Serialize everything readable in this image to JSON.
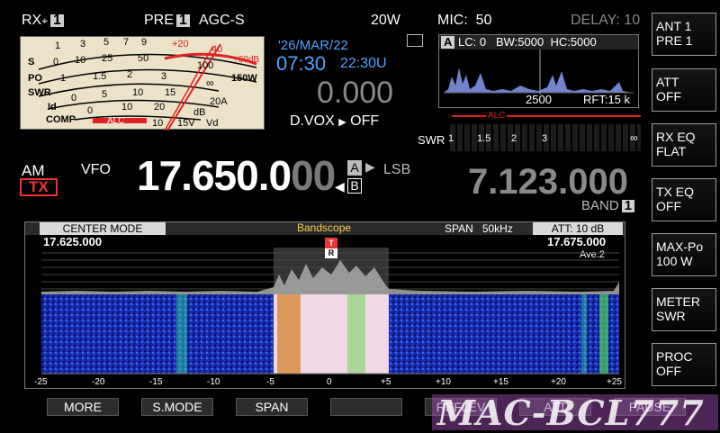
{
  "top": {
    "rx": "RX",
    "rx_badge": "1",
    "pre": "PRE",
    "pre_badge": "1",
    "agc": "AGC-S",
    "power": "20W",
    "mic_label": "MIC:",
    "mic_value": "50",
    "delay": "DELAY: 10"
  },
  "meter": {
    "s_scale_labels": [
      "1",
      "3",
      "5",
      "7",
      "9",
      "+20",
      "40",
      "+60dB"
    ],
    "po_scale_labels": [
      "0",
      "10",
      "25",
      "50",
      "100",
      "150W"
    ],
    "swr_scale_labels": [
      "1",
      "1.5",
      "2",
      "3",
      "∞"
    ],
    "id_scale_labels": [
      "0",
      "5",
      "10",
      "15",
      "20A"
    ],
    "comp_scale_labels": [
      "0",
      "10",
      "20",
      "dB"
    ],
    "vd_scale_labels": [
      "10",
      "15V",
      "Vd"
    ],
    "row_labels": [
      "S",
      "PO",
      "SWR",
      "Id",
      "COMP"
    ],
    "alc_label": "ALC"
  },
  "clock": {
    "date": "'26/MAR/22",
    "time_local": "07:30",
    "time_utc": "22:30U",
    "rit": "0.000",
    "dvox": "D.VOX",
    "dvox_state": "OFF"
  },
  "filter": {
    "badge": "A",
    "lc_label": "LC:",
    "lc_value": "0",
    "bw": "BW:5000",
    "hc": "HC:5000",
    "center_freq": "2500",
    "rft": "RFT:15 k"
  },
  "swr_meter": {
    "alc": "ALC",
    "label": "SWR",
    "ticks": [
      "1",
      "1.5",
      "2",
      "3",
      "∞"
    ]
  },
  "vfo_main": {
    "mode": "AM",
    "tx": "TX",
    "vfo": "VFO",
    "freq_bright": "17.650.0",
    "freq_dim": "00",
    "vfo_a": "A",
    "vfo_b": "B",
    "sideband": "LSB"
  },
  "vfo_sub": {
    "freq": "7.123.000",
    "band_label": "BAND",
    "band_badge": "1"
  },
  "scope": {
    "mode": "CENTER MODE",
    "title": "Bandscope",
    "span_label": "SPAN",
    "span_value": "50kHz",
    "att": "ATT: 10 dB",
    "left_freq": "17.625.000",
    "right_freq": "17.675.000",
    "ave": "Ave.2",
    "tx_marker": "T",
    "rx_marker": "R",
    "ticks": [
      "-25",
      "-20",
      "-15",
      "-10",
      "-5",
      "0",
      "+5",
      "+10",
      "+15",
      "+20",
      "+25"
    ]
  },
  "side_buttons": [
    {
      "line1": "ANT 1",
      "line2": "PRE 1"
    },
    {
      "line1": "ATT",
      "line2": "OFF"
    },
    {
      "line1": "RX EQ",
      "line2": "FLAT"
    },
    {
      "line1": "TX EQ",
      "line2": "OFF"
    },
    {
      "line1": "MAX-Po",
      "line2": "100 W"
    },
    {
      "line1": "METER",
      "line2": "SWR"
    },
    {
      "line1": "PROC",
      "line2": "OFF"
    }
  ],
  "bottom_buttons": [
    "MORE",
    "S.MODE",
    "SPAN",
    "",
    "REFLEV",
    "ATT",
    "PAUSE"
  ],
  "watermark": "MAC-BCL777",
  "colors": {
    "accent_blue": "#4da3ff",
    "tx_red": "#e33",
    "meter_bg": "#ece2c7",
    "alc_red": "#d22"
  }
}
